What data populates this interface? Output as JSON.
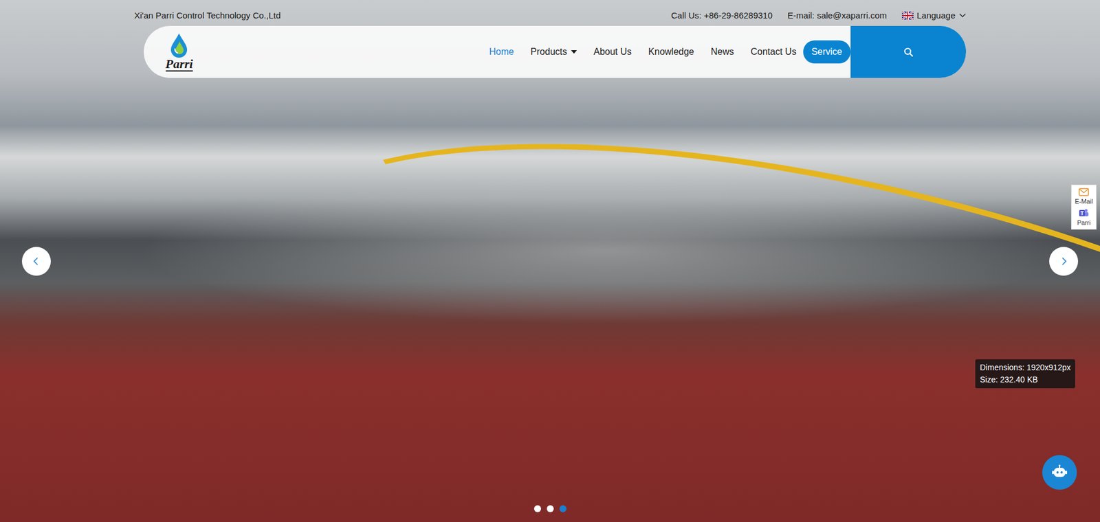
{
  "top_bar": {
    "company": "Xi'an Parri Control Technology Co.,Ltd",
    "phone": "Call Us: +86-29-86289310",
    "email": "E-mail: sale@xaparri.com",
    "language": "Language"
  },
  "logo": {
    "text": "Parri"
  },
  "nav": [
    {
      "label": "Home",
      "selected": true,
      "has_dropdown": false
    },
    {
      "label": "Products",
      "selected": false,
      "has_dropdown": true
    },
    {
      "label": "About Us",
      "selected": false,
      "has_dropdown": false
    },
    {
      "label": "Knowledge",
      "selected": false,
      "has_dropdown": false
    },
    {
      "label": "News",
      "selected": false,
      "has_dropdown": false
    },
    {
      "label": "Contact Us",
      "selected": false,
      "has_dropdown": false
    }
  ],
  "service_button": "Service",
  "side_widget": [
    {
      "label": "E-Mail",
      "kind": "email"
    },
    {
      "label": "Parri",
      "kind": "teams"
    }
  ],
  "carousel": {
    "slides": [
      {
        "selected": false
      },
      {
        "selected": false
      },
      {
        "selected": true
      }
    ]
  },
  "image_info": {
    "dimensions": "Dimensions: 1920x912px",
    "size": "Size: 232.40 KB"
  }
}
